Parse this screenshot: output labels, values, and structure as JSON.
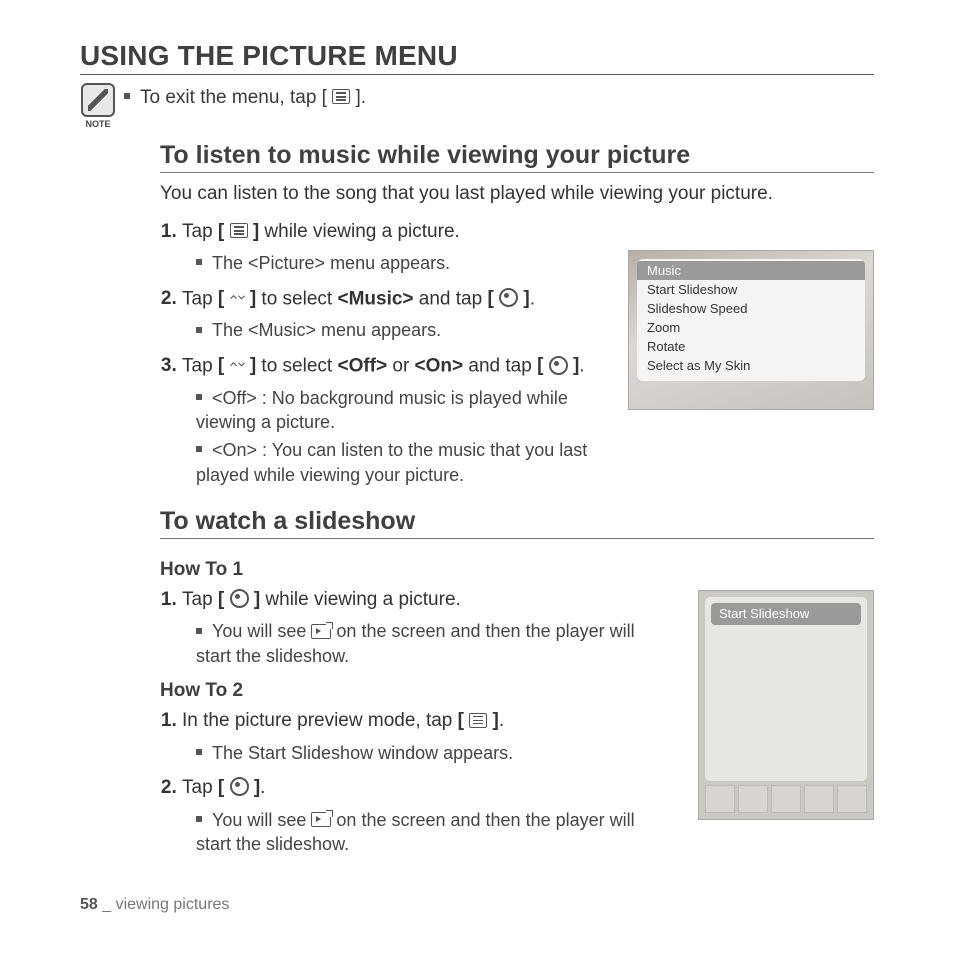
{
  "page_title": "USING THE PICTURE MENU",
  "note": {
    "label": "NOTE",
    "text_pre": "To exit the menu, tap [",
    "text_post": "]."
  },
  "section1": {
    "heading": "To listen to music while viewing your picture",
    "intro": "You can listen to the song that you last played while viewing your picture.",
    "step1_pre": "Tap ",
    "step1_b_open": "[",
    "step1_b_close": "]",
    "step1_post": " while viewing a picture.",
    "step1_sub": "The <Picture> menu appears.",
    "step2_pre": "Tap ",
    "step2_b_open": "[",
    "step2_b_close": "]",
    "step2_mid": " to select ",
    "step2_music": "<Music>",
    "step2_andtap": " and tap ",
    "step2_period": ".",
    "step2_sub": "The <Music> menu appears.",
    "step3_pre": "Tap ",
    "step3_b_open": "[",
    "step3_b_close": "]",
    "step3_mid": " to select ",
    "step3_off": "<Off>",
    "step3_or": " or ",
    "step3_on": "<On>",
    "step3_andtap": " and tap ",
    "step3_period": ".",
    "step3_sub1": "<Off> : No background music is played while viewing a picture.",
    "step3_sub2": "<On> : You can listen to the music that you last played while viewing your picture."
  },
  "menu1": {
    "items": [
      "Music",
      "Start Slideshow",
      "Slideshow Speed",
      "Zoom",
      "Rotate",
      "Select as My Skin"
    ]
  },
  "section2": {
    "heading": "To watch a slideshow",
    "howto1": "How To 1",
    "h1_step1_pre": "Tap ",
    "h1_step1_b_open": "[",
    "h1_step1_b_close": "]",
    "h1_step1_post": " while viewing a picture.",
    "h1_sub_pre": "You will see ",
    "h1_sub_post": " on the screen and then the player will start the slideshow.",
    "howto2": "How To 2",
    "h2_step1_pre": "In the picture preview mode, tap ",
    "h2_step1_b_open": "[",
    "h2_step1_b_close": "]",
    "h2_step1_period": ".",
    "h2_sub1": "The Start Slideshow window appears.",
    "h2_step2_pre": "Tap ",
    "h2_step2_b_open": "[",
    "h2_step2_b_close": "]",
    "h2_step2_period": ".",
    "h2_sub2_pre": "You will see ",
    "h2_sub2_post": " on the screen and then the player will start the slideshow."
  },
  "device2": {
    "label": "Start Slideshow"
  },
  "footer": {
    "page_num": "58",
    "sep": " _ ",
    "chapter": "viewing pictures"
  }
}
